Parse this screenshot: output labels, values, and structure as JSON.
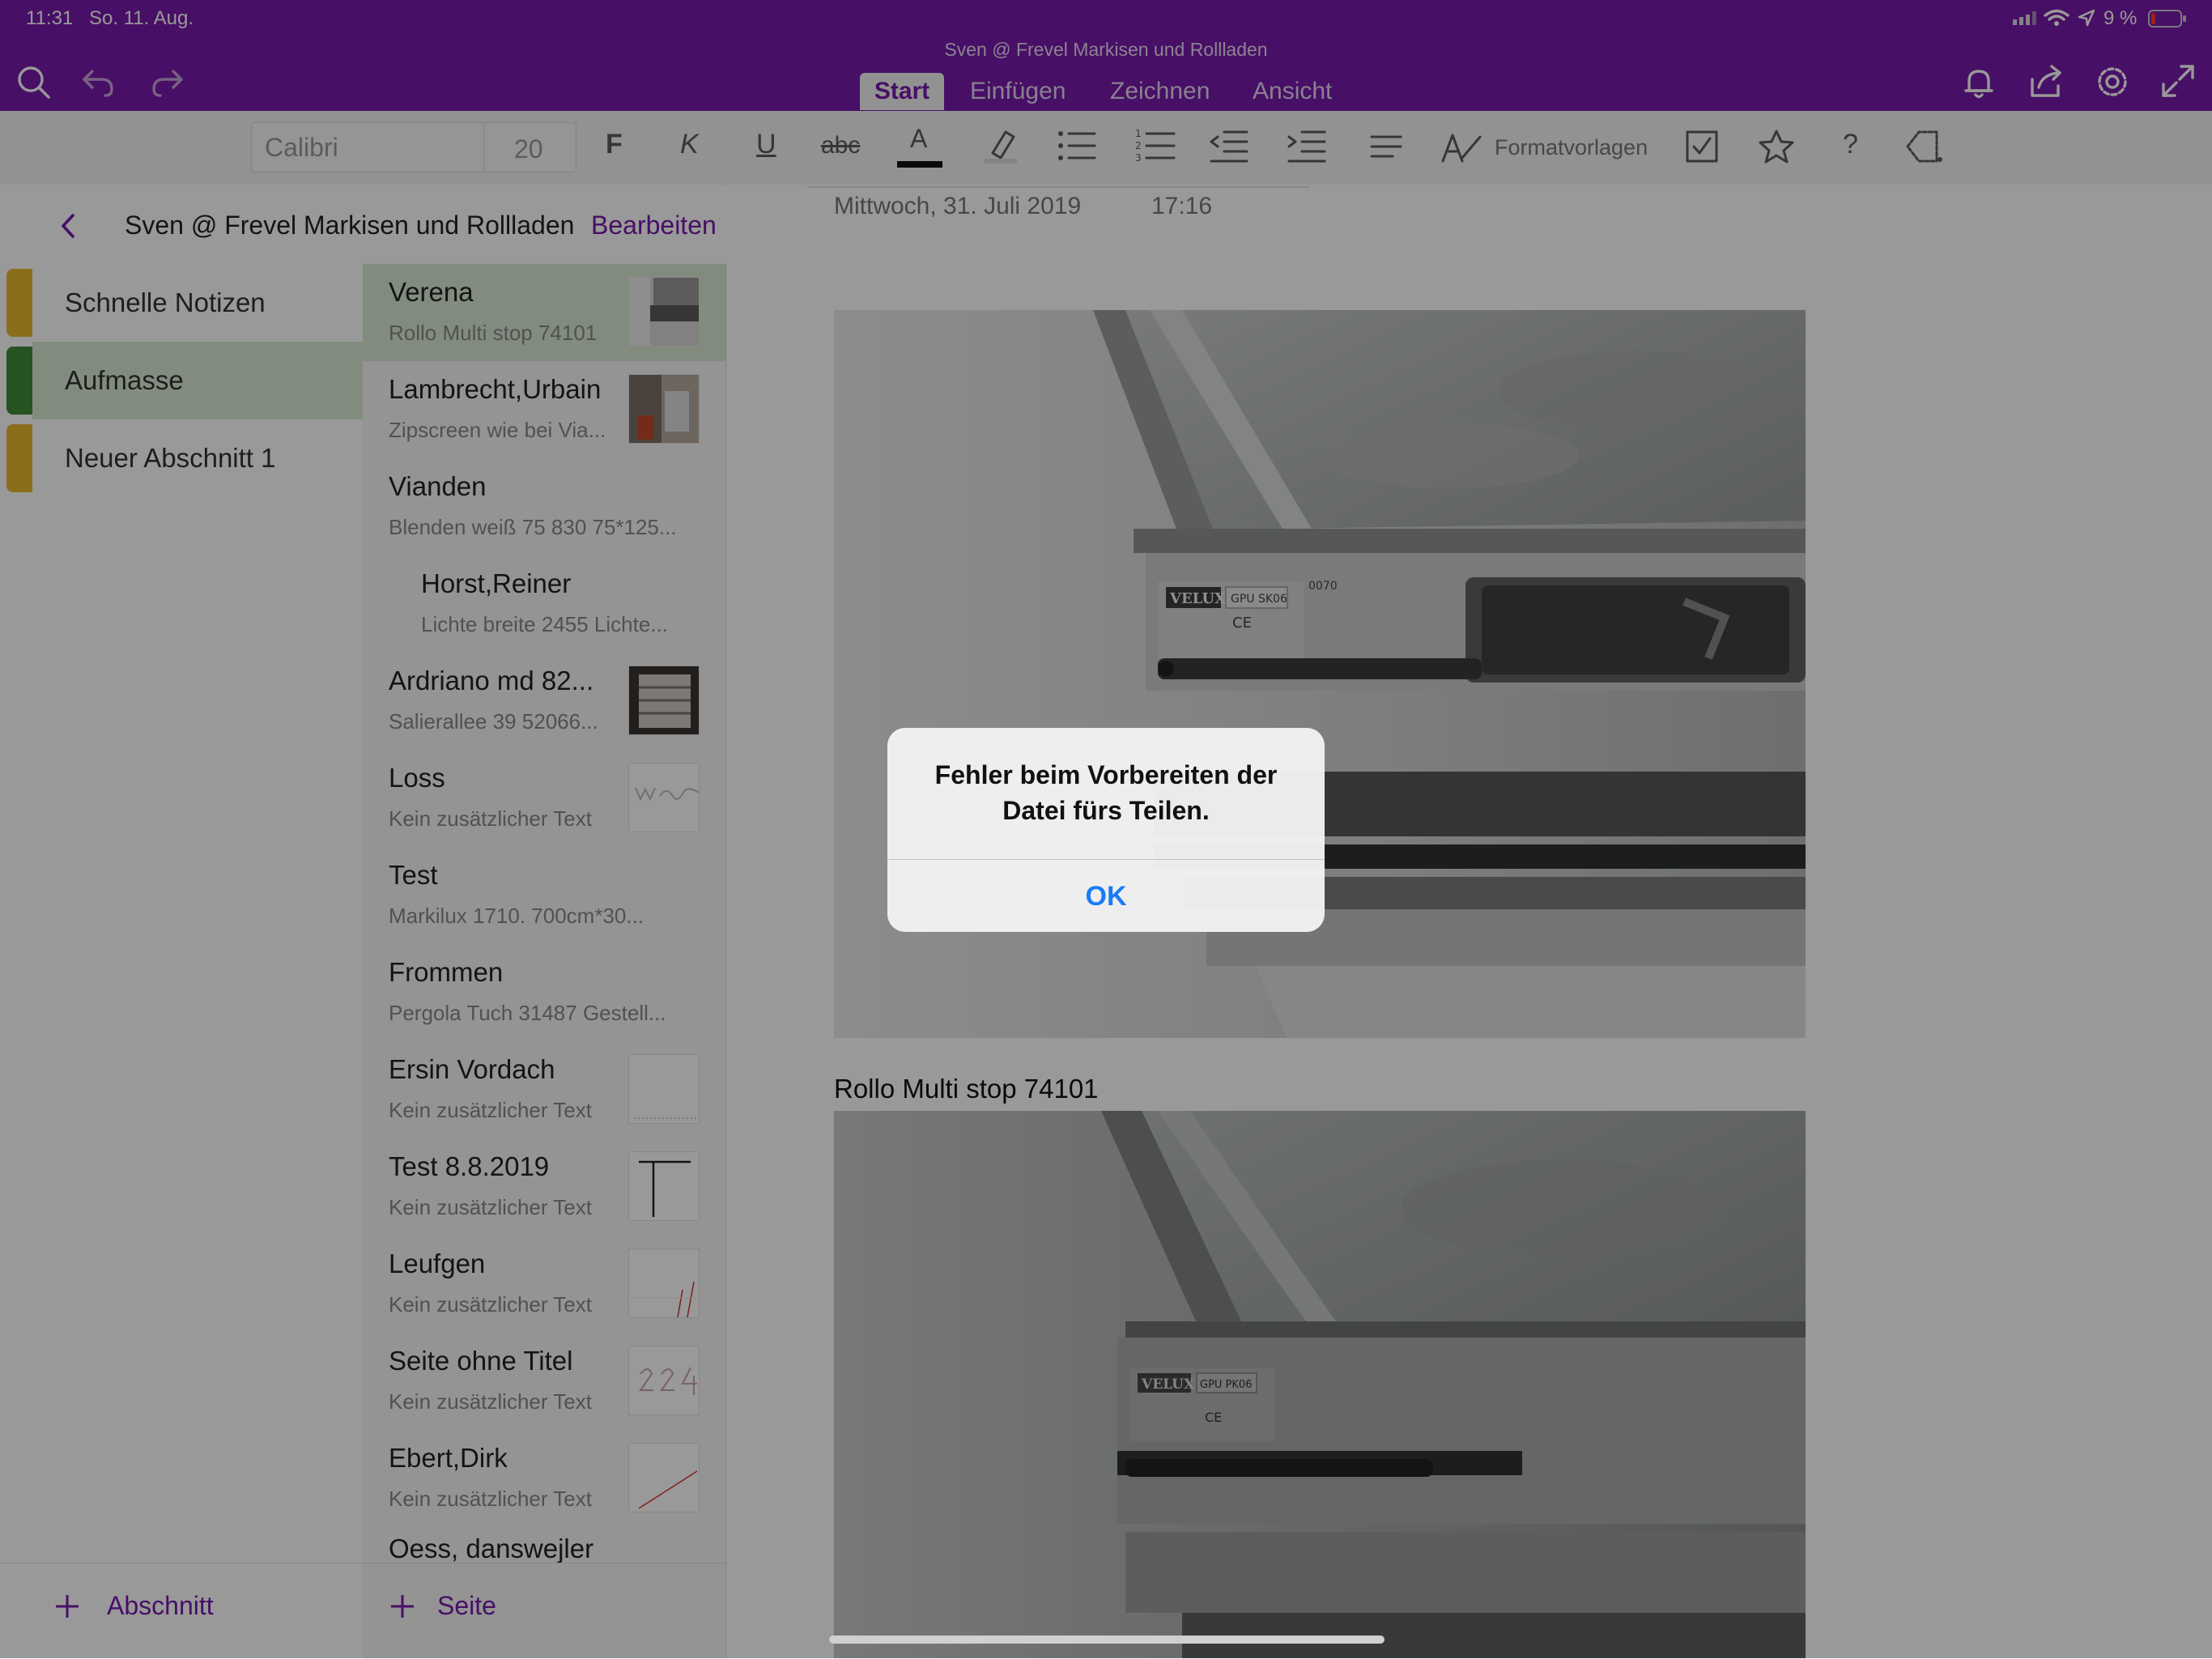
{
  "status_bar": {
    "time": "11:31",
    "date": "So. 11. Aug.",
    "battery": "9 %"
  },
  "header": {
    "notebook_title": "Sven @ Frevel Markisen und Rollladen",
    "tabs": [
      "Start",
      "Einfügen",
      "Zeichnen",
      "Ansicht"
    ]
  },
  "ribbon": {
    "font": "Calibri",
    "size": "20",
    "styles_label": "Formatvorlagen",
    "bold": "F",
    "italic": "K",
    "underline": "U",
    "strike": "abc",
    "font_color_glyph": "A",
    "help": "?"
  },
  "nav": {
    "notebook": "Sven @ Frevel Markisen und Rollladen",
    "edit": "Bearbeiten"
  },
  "sections": [
    {
      "label": "Schnelle Notizen",
      "color": "#e8b72f"
    },
    {
      "label": "Aufmasse",
      "color": "#3e8b3a",
      "selected": true
    },
    {
      "label": "Neuer Abschnitt 1",
      "color": "#e8b72f"
    }
  ],
  "pages": [
    {
      "title": "Verena",
      "sub": "Rollo Multi stop 74101"
    },
    {
      "title": "Lambrecht,Urbain",
      "sub": "Zipscreen wie bei Via..."
    },
    {
      "title": "Vianden",
      "sub": "Blenden weiß 75 830  75*125..."
    },
    {
      "title": "Horst,Reiner",
      "sub": "Lichte breite  2455  Lichte..."
    },
    {
      "title": "Ardriano md 82...",
      "sub": "Salierallee 39  52066..."
    },
    {
      "title": "Loss",
      "sub": "Kein zusätzlicher Text"
    },
    {
      "title": "Test",
      "sub": "Markilux 1710.          700cm*30..."
    },
    {
      "title": "Frommen",
      "sub": "Pergola  Tuch 31487  Gestell..."
    },
    {
      "title": "Ersin Vordach",
      "sub": "Kein zusätzlicher Text"
    },
    {
      "title": "Test 8.8.2019",
      "sub": "Kein zusätzlicher Text"
    },
    {
      "title": "Leufgen",
      "sub": "Kein zusätzlicher Text"
    },
    {
      "title": "Seite ohne Titel",
      "sub": "Kein zusätzlicher Text"
    },
    {
      "title": "Ebert,Dirk",
      "sub": "Kein zusätzlicher Text"
    },
    {
      "title": "Oess, danswejler",
      "sub": ""
    }
  ],
  "footer": {
    "add_section": "Abschnitt",
    "add_page": "Seite"
  },
  "note": {
    "date": "Mittwoch, 31. Juli 2019",
    "time": "17:16",
    "caption": "Rollo Multi stop 74101"
  },
  "photo_labels": {
    "brand": "VELUX",
    "model_1": "GPU SK06",
    "model_2": "GPU PK06",
    "code": "0070",
    "ce": "CE"
  },
  "dialog": {
    "message": "Fehler beim Vorbereiten der Datei fürs Teilen.",
    "ok": "OK"
  }
}
